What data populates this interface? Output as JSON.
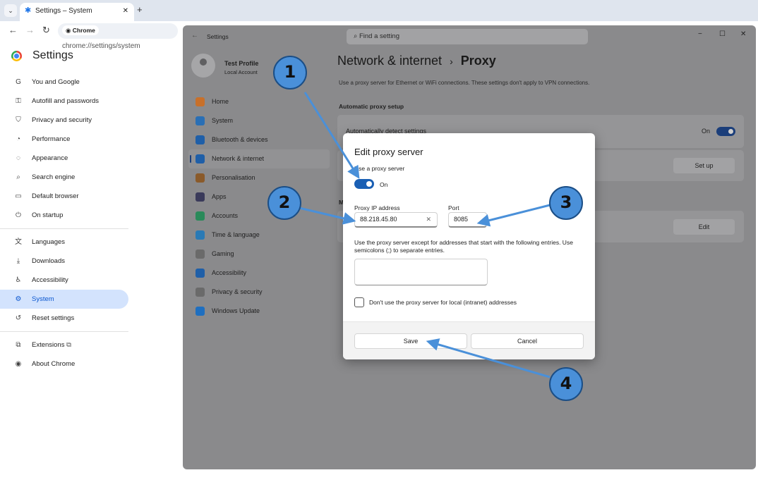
{
  "browser": {
    "tab_title": "Settings – System",
    "url_chip": "Chrome",
    "url": "chrome://settings/system"
  },
  "chrome_settings": {
    "title": "Settings",
    "nav_group1": [
      {
        "label": "You and Google",
        "icon": "G"
      },
      {
        "label": "Autofill and passwords",
        "icon": "⚿"
      },
      {
        "label": "Privacy and security",
        "icon": "⛉"
      },
      {
        "label": "Performance",
        "icon": "◔"
      },
      {
        "label": "Appearance",
        "icon": "◌"
      },
      {
        "label": "Search engine",
        "icon": "⌕"
      },
      {
        "label": "Default browser",
        "icon": "▭"
      },
      {
        "label": "On startup",
        "icon": "⏻"
      }
    ],
    "nav_group2": [
      {
        "label": "Languages",
        "icon": "文"
      },
      {
        "label": "Downloads",
        "icon": "⤓"
      },
      {
        "label": "Accessibility",
        "icon": "♿"
      },
      {
        "label": "System",
        "icon": "⚙"
      },
      {
        "label": "Reset settings",
        "icon": "↺"
      }
    ],
    "nav_group3": [
      {
        "label": "Extensions",
        "icon": "⧉"
      },
      {
        "label": "About Chrome",
        "icon": "◉"
      }
    ],
    "active_item": "System"
  },
  "windows_settings": {
    "app_title": "Settings",
    "search_placeholder": "Find a setting",
    "profile": {
      "name": "Test Profile",
      "account": "Local Account"
    },
    "nav": [
      {
        "label": "Home",
        "icon_color": "#c8702a"
      },
      {
        "label": "System",
        "icon_color": "#2a6fb5"
      },
      {
        "label": "Bluetooth & devices",
        "icon_color": "#1f5fa8"
      },
      {
        "label": "Network & internet",
        "icon_color": "#1f5fa8"
      },
      {
        "label": "Personalisation",
        "icon_color": "#8a5a2a"
      },
      {
        "label": "Apps",
        "icon_color": "#3a3a5a"
      },
      {
        "label": "Accounts",
        "icon_color": "#2a8a5a"
      },
      {
        "label": "Time & language",
        "icon_color": "#2a7ab5"
      },
      {
        "label": "Gaming",
        "icon_color": "#6a6a6a"
      },
      {
        "label": "Accessibility",
        "icon_color": "#1f5fa8"
      },
      {
        "label": "Privacy & security",
        "icon_color": "#6a6a6a"
      },
      {
        "label": "Windows Update",
        "icon_color": "#1f6fc0"
      }
    ],
    "selected_nav": "Network & internet",
    "breadcrumb_parent": "Network & internet",
    "breadcrumb_sep": "›",
    "breadcrumb_current": "Proxy",
    "description": "Use a proxy server for Ethernet or WiFi connections. These settings don't apply to VPN connections.",
    "auto_section_heading": "Automatic proxy setup",
    "auto_detect_label": "Automatically detect settings",
    "auto_detect_state": "On",
    "setup_button": "Set up",
    "manual_section_heading_fragment": "M",
    "edit_button": "Edit"
  },
  "dialog": {
    "title": "Edit proxy server",
    "use_proxy_label": "Use a proxy server",
    "use_proxy_state": "On",
    "ip_label": "Proxy IP address",
    "ip_value": "88.218.45.80",
    "port_label": "Port",
    "port_value": "8085",
    "exceptions_help": "Use the proxy server except for addresses that start with the following entries. Use semicolons (;) to separate entries.",
    "exceptions_value": "",
    "local_checkbox_label": "Don't use the proxy server for local (intranet) addresses",
    "local_checkbox_checked": false,
    "save_button": "Save",
    "cancel_button": "Cancel"
  },
  "annotations": {
    "step1": "1",
    "step2": "2",
    "step3": "3",
    "step4": "4",
    "color": "#4a90d9"
  }
}
